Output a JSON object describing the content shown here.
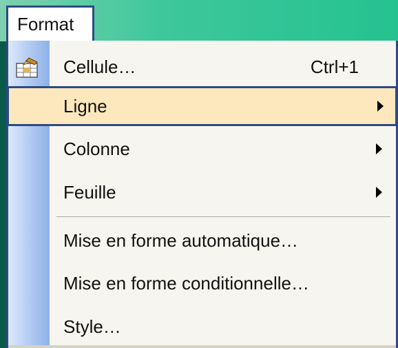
{
  "menubar": {
    "format_label": "Format"
  },
  "menu": {
    "items": [
      {
        "label": "Cellule…",
        "shortcut": "Ctrl+1",
        "icon": "format-cells-icon"
      },
      {
        "label": "Ligne",
        "submenu": true
      },
      {
        "label": "Colonne",
        "submenu": true
      },
      {
        "label": "Feuille",
        "submenu": true
      },
      {
        "label": "Mise en forme automatique…"
      },
      {
        "label": "Mise en forme conditionnelle…"
      },
      {
        "label": "Style…"
      }
    ]
  },
  "colors": {
    "highlight_fill": "#fde8bd",
    "highlight_border": "#2c4a86",
    "menu_background": "#f7f5ef",
    "menubar_green": "#25c290"
  }
}
